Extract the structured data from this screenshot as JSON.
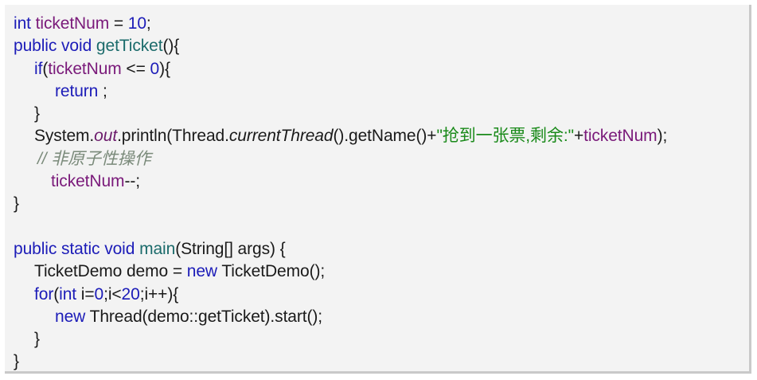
{
  "lines": [
    {
      "id": "l1",
      "tokens": [
        {
          "t": "int",
          "c": "kw"
        },
        {
          "t": " ",
          "c": "txt"
        },
        {
          "t": "ticketNum",
          "c": "fld"
        },
        {
          "t": " = ",
          "c": "txt"
        },
        {
          "t": "10",
          "c": "num"
        },
        {
          "t": ";",
          "c": "txt"
        }
      ],
      "indent": ""
    },
    {
      "id": "l2",
      "tokens": [
        {
          "t": "public",
          "c": "kw"
        },
        {
          "t": " ",
          "c": "txt"
        },
        {
          "t": "void",
          "c": "kw"
        },
        {
          "t": " ",
          "c": "txt"
        },
        {
          "t": "getTicket",
          "c": "mth"
        },
        {
          "t": "(){",
          "c": "txt"
        }
      ],
      "indent": ""
    },
    {
      "id": "l3",
      "tokens": [
        {
          "t": "if",
          "c": "kw"
        },
        {
          "t": "(",
          "c": "txt"
        },
        {
          "t": "ticketNum",
          "c": "fld"
        },
        {
          "t": " <= ",
          "c": "txt"
        },
        {
          "t": "0",
          "c": "num"
        },
        {
          "t": "){",
          "c": "txt"
        }
      ],
      "indent": "ind1"
    },
    {
      "id": "l4",
      "tokens": [
        {
          "t": "return",
          "c": "kw"
        },
        {
          "t": " ;",
          "c": "txt"
        }
      ],
      "indent": "ind2"
    },
    {
      "id": "l5",
      "tokens": [
        {
          "t": "}",
          "c": "txt"
        }
      ],
      "indent": "ind1"
    },
    {
      "id": "l6",
      "tokens": [
        {
          "t": "System.",
          "c": "txt"
        },
        {
          "t": "out",
          "c": "out"
        },
        {
          "t": ".println(Thread.",
          "c": "txt"
        },
        {
          "t": "currentThread",
          "c": "txt ital"
        },
        {
          "t": "().getName()+",
          "c": "txt"
        },
        {
          "t": "\"抢到一张票,剩余:\"",
          "c": "str"
        },
        {
          "t": "+",
          "c": "txt"
        },
        {
          "t": "ticketNum",
          "c": "fld"
        },
        {
          "t": ");",
          "c": "txt"
        }
      ],
      "indent": "ind1"
    },
    {
      "id": "l7",
      "tokens": [
        {
          "t": "// 非原子性操作",
          "c": "cmt"
        }
      ],
      "indent": "ind1c"
    },
    {
      "id": "l8",
      "tokens": [
        {
          "t": "ticketNum",
          "c": "fld"
        },
        {
          "t": "--;",
          "c": "txt"
        }
      ],
      "indent": "ind1b"
    },
    {
      "id": "l9",
      "tokens": [
        {
          "t": "}",
          "c": "txt"
        }
      ],
      "indent": ""
    },
    {
      "id": "l10",
      "tokens": [],
      "indent": ""
    },
    {
      "id": "l11",
      "tokens": [
        {
          "t": "public",
          "c": "kw"
        },
        {
          "t": " ",
          "c": "txt"
        },
        {
          "t": "static",
          "c": "kw"
        },
        {
          "t": " ",
          "c": "txt"
        },
        {
          "t": "void",
          "c": "kw"
        },
        {
          "t": " ",
          "c": "txt"
        },
        {
          "t": "main",
          "c": "mth"
        },
        {
          "t": "(String[] args) {",
          "c": "txt"
        }
      ],
      "indent": ""
    },
    {
      "id": "l12",
      "tokens": [
        {
          "t": "TicketDemo demo = ",
          "c": "txt"
        },
        {
          "t": "new",
          "c": "kw"
        },
        {
          "t": " TicketDemo();",
          "c": "txt"
        }
      ],
      "indent": "ind1"
    },
    {
      "id": "l13",
      "tokens": [
        {
          "t": "for",
          "c": "kw"
        },
        {
          "t": "(",
          "c": "txt"
        },
        {
          "t": "int",
          "c": "kw"
        },
        {
          "t": " i=",
          "c": "txt"
        },
        {
          "t": "0",
          "c": "num"
        },
        {
          "t": ";i<",
          "c": "txt"
        },
        {
          "t": "20",
          "c": "num"
        },
        {
          "t": ";i++){",
          "c": "txt"
        }
      ],
      "indent": "ind1"
    },
    {
      "id": "l14",
      "tokens": [
        {
          "t": "new",
          "c": "kw"
        },
        {
          "t": " Thread(demo::getTicket).start();",
          "c": "txt"
        }
      ],
      "indent": "ind2"
    },
    {
      "id": "l15",
      "tokens": [
        {
          "t": "}",
          "c": "txt"
        }
      ],
      "indent": "ind1"
    },
    {
      "id": "l16",
      "tokens": [
        {
          "t": "}",
          "c": "txt"
        }
      ],
      "indent": ""
    }
  ]
}
